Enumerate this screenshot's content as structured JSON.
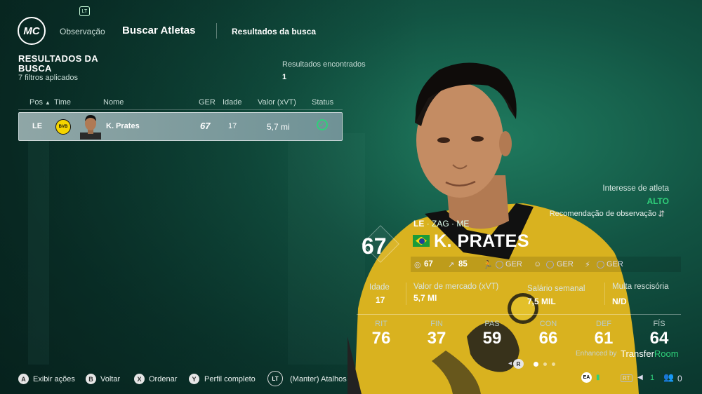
{
  "header": {
    "logo_text": "MC",
    "lt_badge": "LT",
    "nav_observacao": "Observação",
    "nav_buscar": "Buscar Atletas",
    "nav_resultados": "Resultados da busca"
  },
  "results": {
    "title": "RESULTADOS DA BUSCA",
    "filters": "7 filtros aplicados",
    "found_label": "Resultados encontrados",
    "found_value": "1",
    "columns": {
      "pos": "Pos",
      "time": "Time",
      "nome": "Nome",
      "ger": "GER",
      "idade": "Idade",
      "valor": "Valor (xVT)",
      "status": "Status"
    },
    "rows": [
      {
        "pos": "LE",
        "team_badge": "BVB",
        "nome": "K. Prates",
        "ger": "67",
        "idade": "17",
        "valor": "5,7 mi"
      }
    ]
  },
  "interest": {
    "label": "Interesse de atleta",
    "value": "ALTO",
    "recommendation": "Recomendação de observação"
  },
  "player": {
    "pos_main": "LE",
    "pos_alt": "· ZAG · ME",
    "overall": "67",
    "name": "K. PRATES",
    "nationality": "Brazil",
    "stats_bar": {
      "ovr": "67",
      "potential": "85",
      "ger1": "GER",
      "ger2": "GER",
      "ger3": "GER"
    },
    "info": [
      {
        "label": "Idade",
        "value": "17"
      },
      {
        "label": "Valor de mercado (xVT)",
        "value": "5,7 MI"
      },
      {
        "label": "Salário semanal",
        "value": "7,5 MIL"
      },
      {
        "label": "Multa rescisória",
        "value": "N/D"
      }
    ],
    "attributes": [
      {
        "label": "RIT",
        "value": "76"
      },
      {
        "label": "FIN",
        "value": "37"
      },
      {
        "label": "PAS",
        "value": "59"
      },
      {
        "label": "CON",
        "value": "66"
      },
      {
        "label": "DEF",
        "value": "61"
      },
      {
        "label": "FÍS",
        "value": "64"
      }
    ],
    "enhanced_by": "Enhanced by",
    "brand_a": "Transfer",
    "brand_b": "Room",
    "pager_btn": "R"
  },
  "footer": {
    "a": {
      "key": "A",
      "label": "Exibir ações"
    },
    "b": {
      "key": "B",
      "label": "Voltar"
    },
    "x": {
      "key": "X",
      "label": "Ordenar"
    },
    "y": {
      "key": "Y",
      "label": "Perfil completo"
    },
    "lt": {
      "key": "LT",
      "label": "(Manter) Atalhos"
    },
    "sys_rt": "RT",
    "sys_count": "1",
    "sys_friends": "0"
  },
  "colors": {
    "accent_green": "#2fd07a",
    "club_yellow": "#f5d500",
    "bg_teal": "#125443"
  }
}
